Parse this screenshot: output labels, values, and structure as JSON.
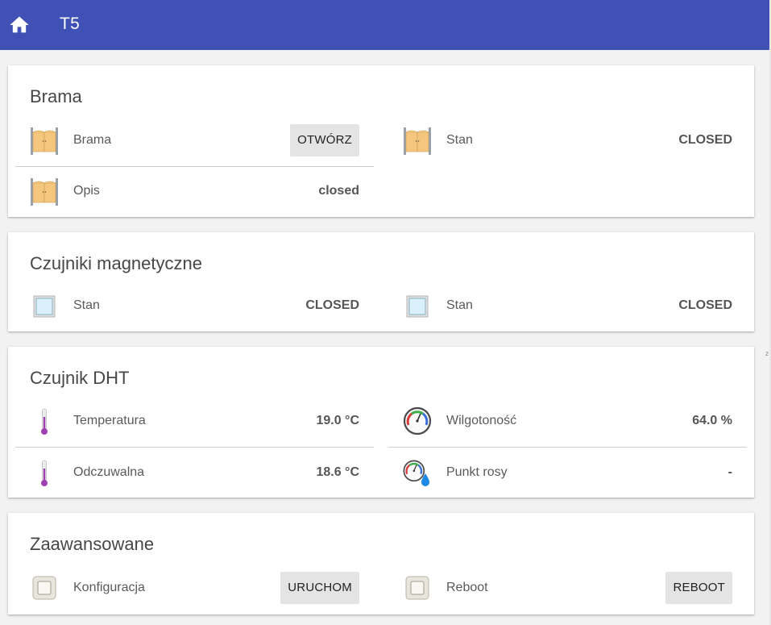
{
  "header": {
    "title": "T5",
    "home_icon": "home-icon",
    "bg_color": "#3f51b5"
  },
  "cards": [
    {
      "title": "Brama",
      "rows": [
        {
          "icon": "gate-icon",
          "label": "Brama",
          "button": "OTWÓRZ"
        },
        {
          "icon": "gate-icon",
          "label": "Stan",
          "value": "CLOSED"
        },
        {
          "icon": "gate-icon",
          "label": "Opis",
          "value": "closed"
        }
      ]
    },
    {
      "title": "Czujniki magnetyczne",
      "rows": [
        {
          "icon": "window-icon",
          "label": "Stan",
          "value": "CLOSED"
        },
        {
          "icon": "window-icon",
          "label": "Stan",
          "value": "CLOSED"
        }
      ]
    },
    {
      "title": "Czujnik DHT",
      "rows": [
        {
          "icon": "thermometer-icon",
          "label": "Temperatura",
          "value": "19.0 °C"
        },
        {
          "icon": "hygrometer-icon",
          "label": "Wilgotoność",
          "value": "64.0 %"
        },
        {
          "icon": "thermometer-icon",
          "label": "Odczuwalna",
          "value": "18.6 °C"
        },
        {
          "icon": "dew-point-icon",
          "label": "Punkt rosy",
          "value": "-"
        }
      ]
    },
    {
      "title": "Zaawansowane",
      "rows": [
        {
          "icon": "switch-icon",
          "label": "Konfiguracja",
          "button": "URUCHOM"
        },
        {
          "icon": "switch-icon",
          "label": "Reboot",
          "button": "REBOOT"
        }
      ]
    }
  ]
}
